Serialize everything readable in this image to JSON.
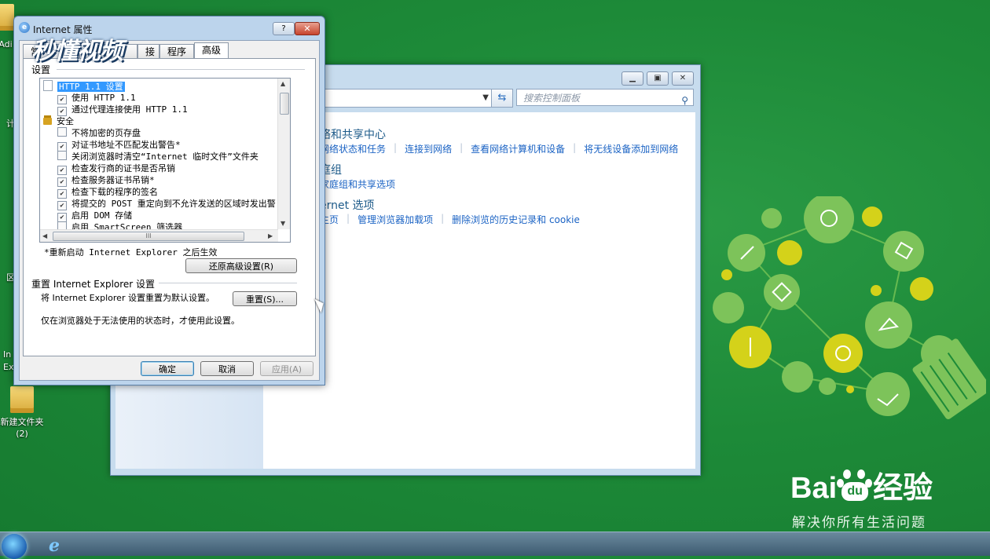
{
  "desktop": {
    "icons": [
      {
        "label_line1": "新建文件夹",
        "label_line2": "(2)"
      }
    ],
    "edge_labels": [
      "Adi",
      "计",
      "区",
      "In",
      "Ex"
    ]
  },
  "watermark": {
    "logo_text": "秒懂视频"
  },
  "control_panel": {
    "search_placeholder": "搜索控制面板",
    "categories": [
      {
        "title": "络和共享中心",
        "links": [
          "网络状态和任务",
          "连接到网络",
          "查看网络计算机和设备",
          "将无线设备添加到网络"
        ]
      },
      {
        "title": "庭组",
        "links": [
          "家庭组和共享选项"
        ]
      },
      {
        "title": "ernet 选项",
        "links": [
          "主页",
          "管理浏览器加载项",
          "删除浏览的历史记录和 cookie"
        ]
      }
    ]
  },
  "dialog": {
    "title": "Internet 属性",
    "tabs": [
      "常",
      "接",
      "程序",
      "高级"
    ],
    "settings_label": "设置",
    "tree_items": [
      {
        "kind": "header",
        "text": "HTTP 1.1 设置",
        "selected": true
      },
      {
        "kind": "check",
        "text": "使用 HTTP 1.1",
        "checked": true
      },
      {
        "kind": "check",
        "text": "通过代理连接使用 HTTP 1.1",
        "checked": true
      },
      {
        "kind": "lock",
        "text": "安全"
      },
      {
        "kind": "check",
        "text": "不将加密的页存盘",
        "checked": false
      },
      {
        "kind": "check",
        "text": "对证书地址不匹配发出警告*",
        "checked": true
      },
      {
        "kind": "check",
        "text": "关闭浏览器时清空“Internet 临时文件”文件夹",
        "checked": false
      },
      {
        "kind": "check",
        "text": "检查发行商的证书是否吊销",
        "checked": true
      },
      {
        "kind": "check",
        "text": "检查服务器证书吊销*",
        "checked": true
      },
      {
        "kind": "check",
        "text": "检查下载的程序的签名",
        "checked": true
      },
      {
        "kind": "check",
        "text": "将提交的 POST 重定向到不允许发送的区域时发出警",
        "checked": true
      },
      {
        "kind": "check",
        "text": "启用 DOM 存储",
        "checked": true
      },
      {
        "kind": "check",
        "text": "启用 SmartScreen 筛选器",
        "checked": false
      }
    ],
    "hscroll_grip": "III",
    "restart_note": "*重新启动 Internet Explorer 之后生效",
    "restore_button": "还原高级设置(R)",
    "reset_group_label": "重置 Internet Explorer 设置",
    "reset_desc": "将 Internet Explorer 设置重置为默认设置。",
    "reset_button": "重置(S)...",
    "reset_warning": "仅在浏览器处于无法使用的状态时，才使用此设置。",
    "ok_button": "确定",
    "cancel_button": "取消",
    "apply_button": "应用(A)"
  },
  "baidu": {
    "logo": "Bai经验",
    "logo_part1": "Bai",
    "logo_paw": "du",
    "logo_part2": "经验",
    "slogan": "解决你所有生活问题"
  },
  "colors": {
    "desktop_green": "#1d8a38",
    "link_blue": "#1b63c4",
    "selection_blue": "#3399ff",
    "bulb_green": "#7dc35a",
    "bulb_yellow": "#d4d21a"
  }
}
